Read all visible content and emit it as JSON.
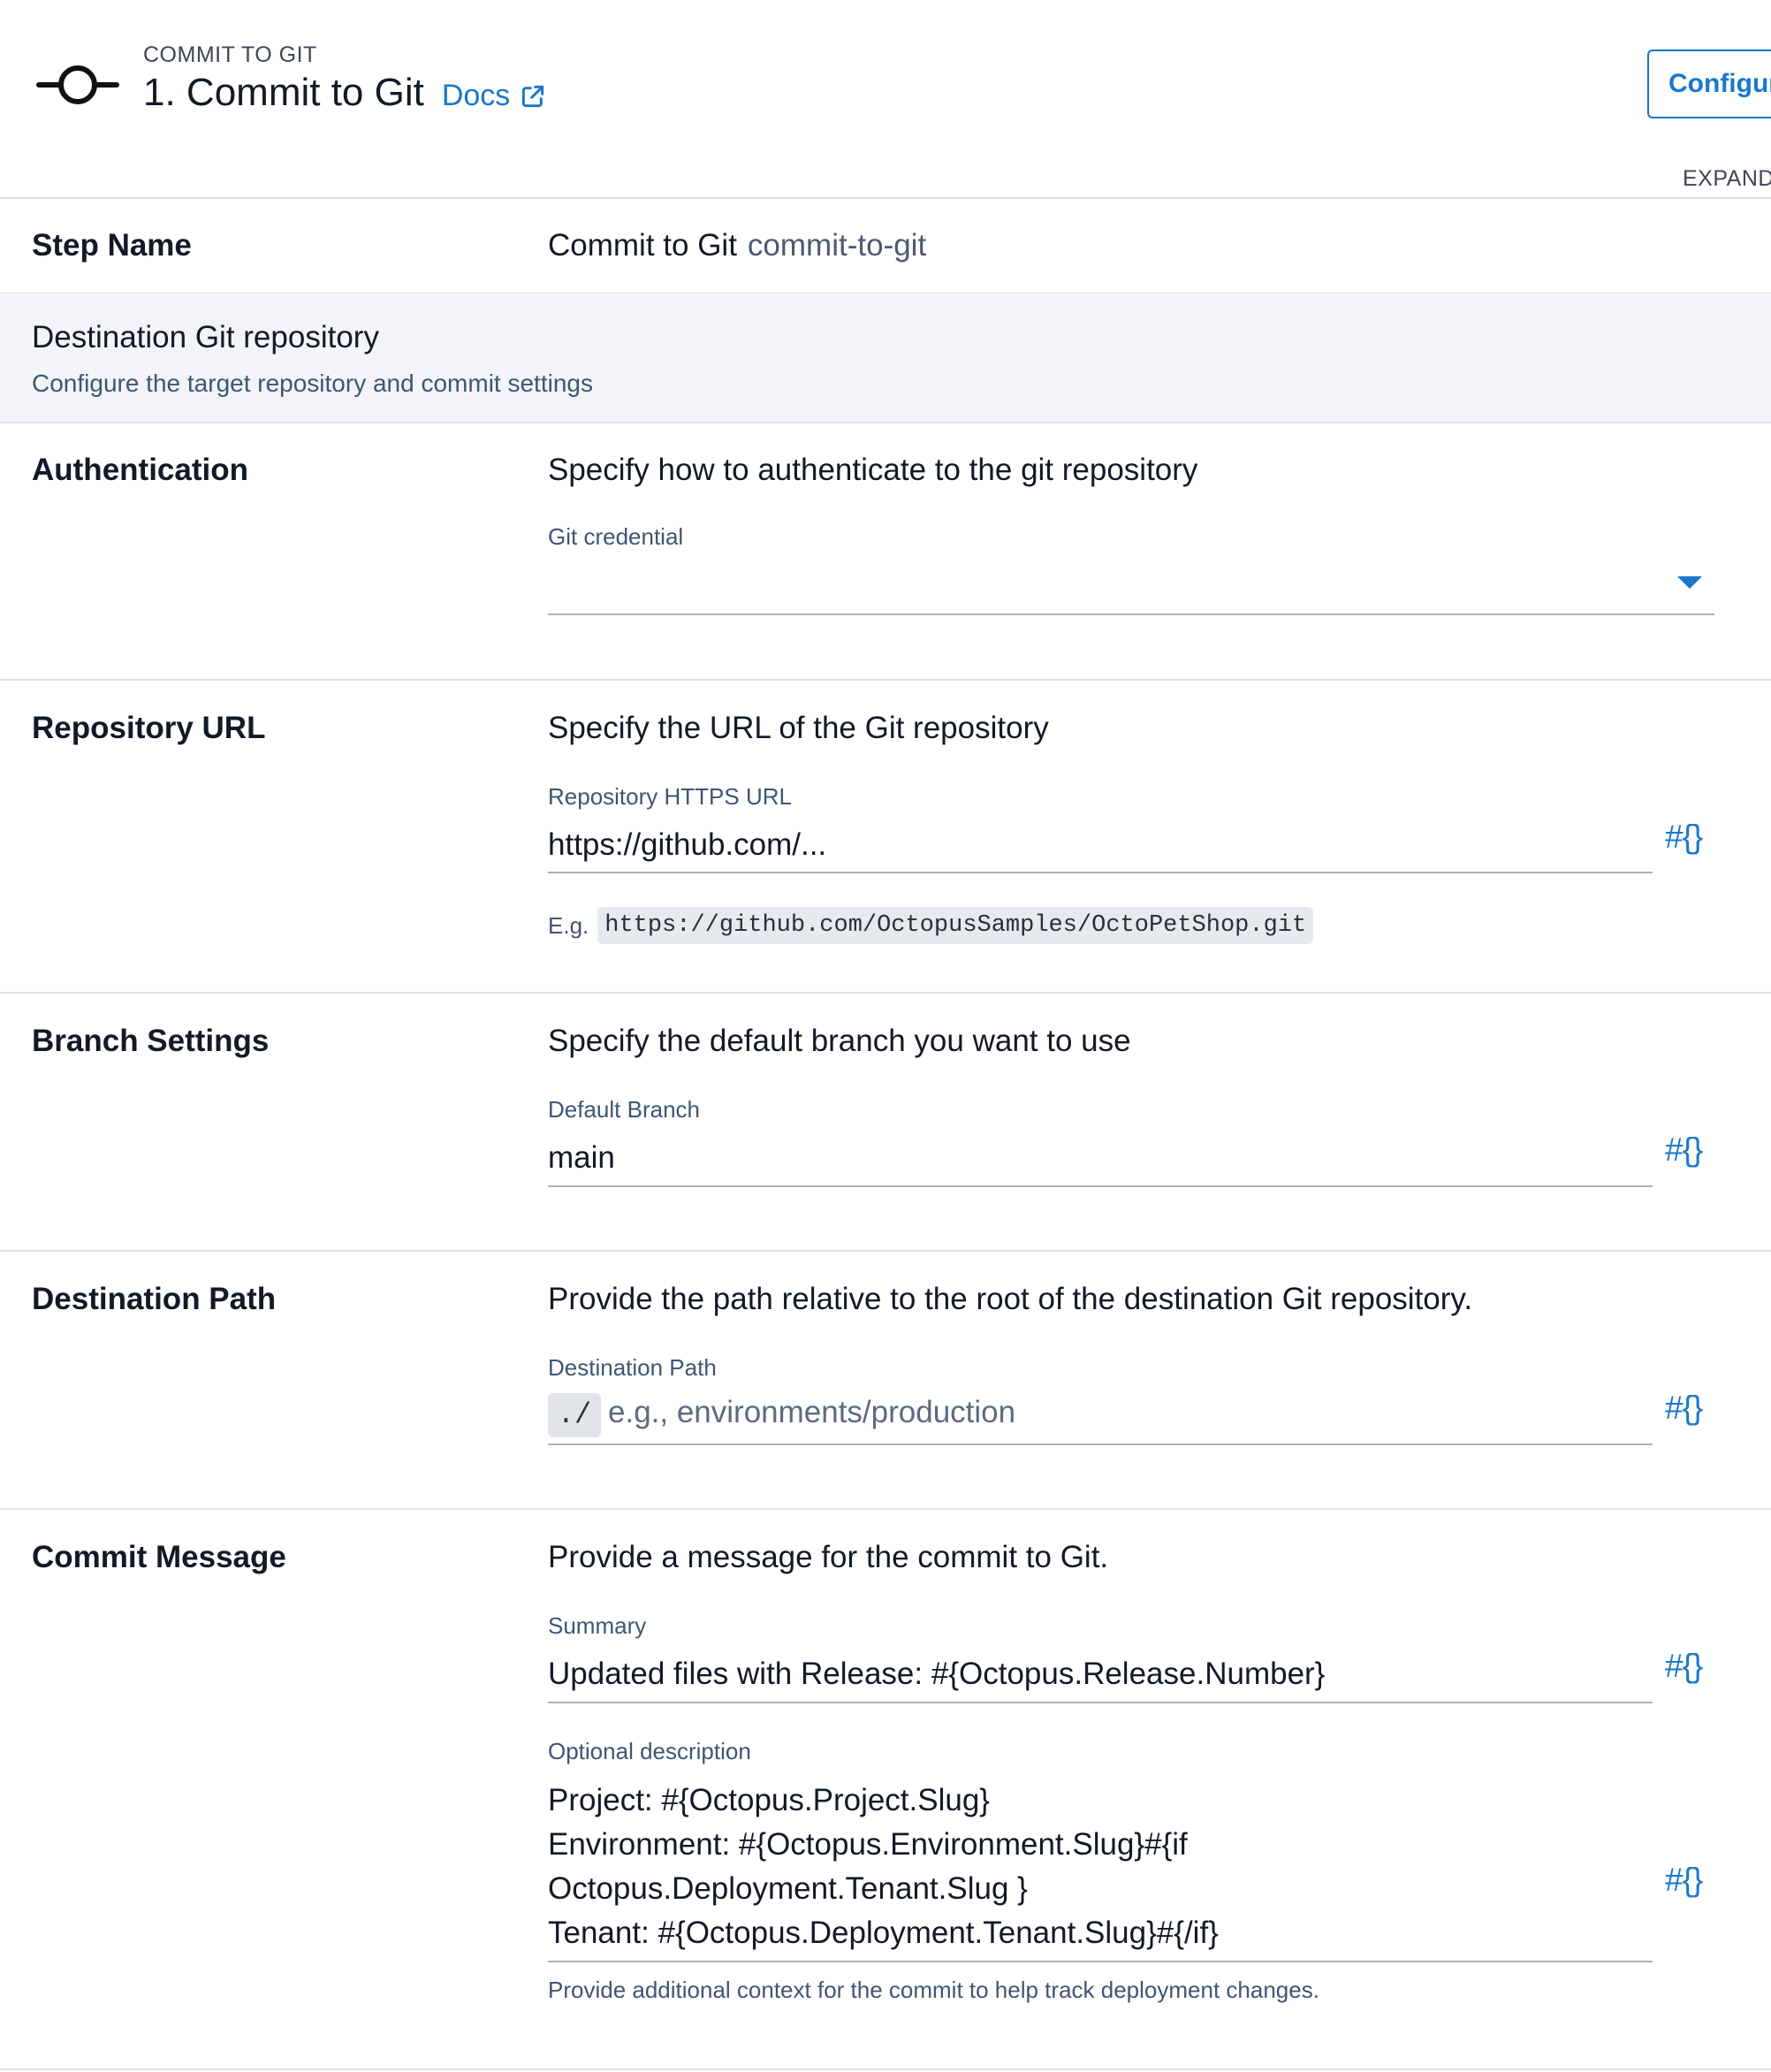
{
  "header": {
    "overline": "COMMIT TO GIT",
    "title": "1. Commit to Git",
    "docs_label": "Docs",
    "configure_label": "Configure",
    "expand_label": "EXPAND ALL"
  },
  "step_name": {
    "label": "Step Name",
    "value": "Commit to Git",
    "slug": "commit-to-git"
  },
  "group": {
    "title": "Destination Git repository",
    "subtitle": "Configure the target repository and commit settings"
  },
  "authentication": {
    "label": "Authentication",
    "description": "Specify how to authenticate to the git repository",
    "field_label": "Git credential",
    "value": ""
  },
  "repository_url": {
    "label": "Repository URL",
    "description": "Specify the URL of the Git repository",
    "field_label": "Repository HTTPS URL",
    "value": "https://github.com/...",
    "hint_prefix": "E.g.",
    "hint_example": "https://github.com/OctopusSamples/OctoPetShop.git"
  },
  "branch": {
    "label": "Branch Settings",
    "description": "Specify the default branch you want to use",
    "field_label": "Default Branch",
    "value": "main"
  },
  "destination_path": {
    "label": "Destination Path",
    "description": "Provide the path relative to the root of the destination Git repository.",
    "field_label": "Destination Path",
    "prefix": "./",
    "placeholder": "e.g., environments/production"
  },
  "commit_message": {
    "label": "Commit Message",
    "description": "Provide a message for the commit to Git.",
    "summary_label": "Summary",
    "summary_value": "Updated files with Release: #{Octopus.Release.Number}",
    "optional_label": "Optional description",
    "optional_lines": [
      "Project: #{Octopus.Project.Slug}",
      "Environment: #{Octopus.Environment.Slug}#{if",
      "Octopus.Deployment.Tenant.Slug }",
      "Tenant: #{Octopus.Deployment.Tenant.Slug}#{/if}"
    ],
    "helper": "Provide additional context for the commit to help track deployment changes."
  },
  "variable_button_label": "#{}",
  "icons": {
    "step": "git-commit-icon",
    "external": "external-link-icon",
    "dropdown": "caret-down-icon"
  },
  "colors": {
    "accent": "#1a77ca",
    "group_band": "#f2f4f7",
    "divider": "#dde1e6"
  }
}
